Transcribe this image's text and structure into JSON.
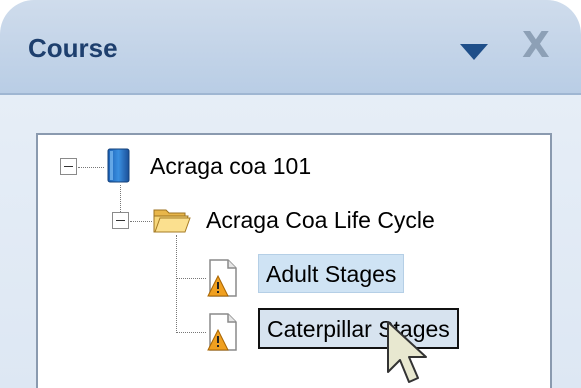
{
  "panel": {
    "title": "Course",
    "dropdown_icon": "chevron-down-icon",
    "close_icon": "close-icon",
    "close_glyph": "X"
  },
  "tree": {
    "root": {
      "label": "Acraga coa 101",
      "icon": "course-icon"
    },
    "folder": {
      "label": "Acraga Coa Life Cycle",
      "icon": "folder-open-icon"
    },
    "items": [
      {
        "label": "Adult Stages",
        "icon": "warning-document-icon"
      },
      {
        "label": "Caterpillar Stages",
        "icon": "warning-document-icon"
      }
    ]
  },
  "colors": {
    "header": "#b9cde5",
    "title": "#1e3f6e",
    "selection": "#cfe3f4",
    "warning": "#f0a020"
  },
  "cursor_icon": "mouse-pointer-icon"
}
